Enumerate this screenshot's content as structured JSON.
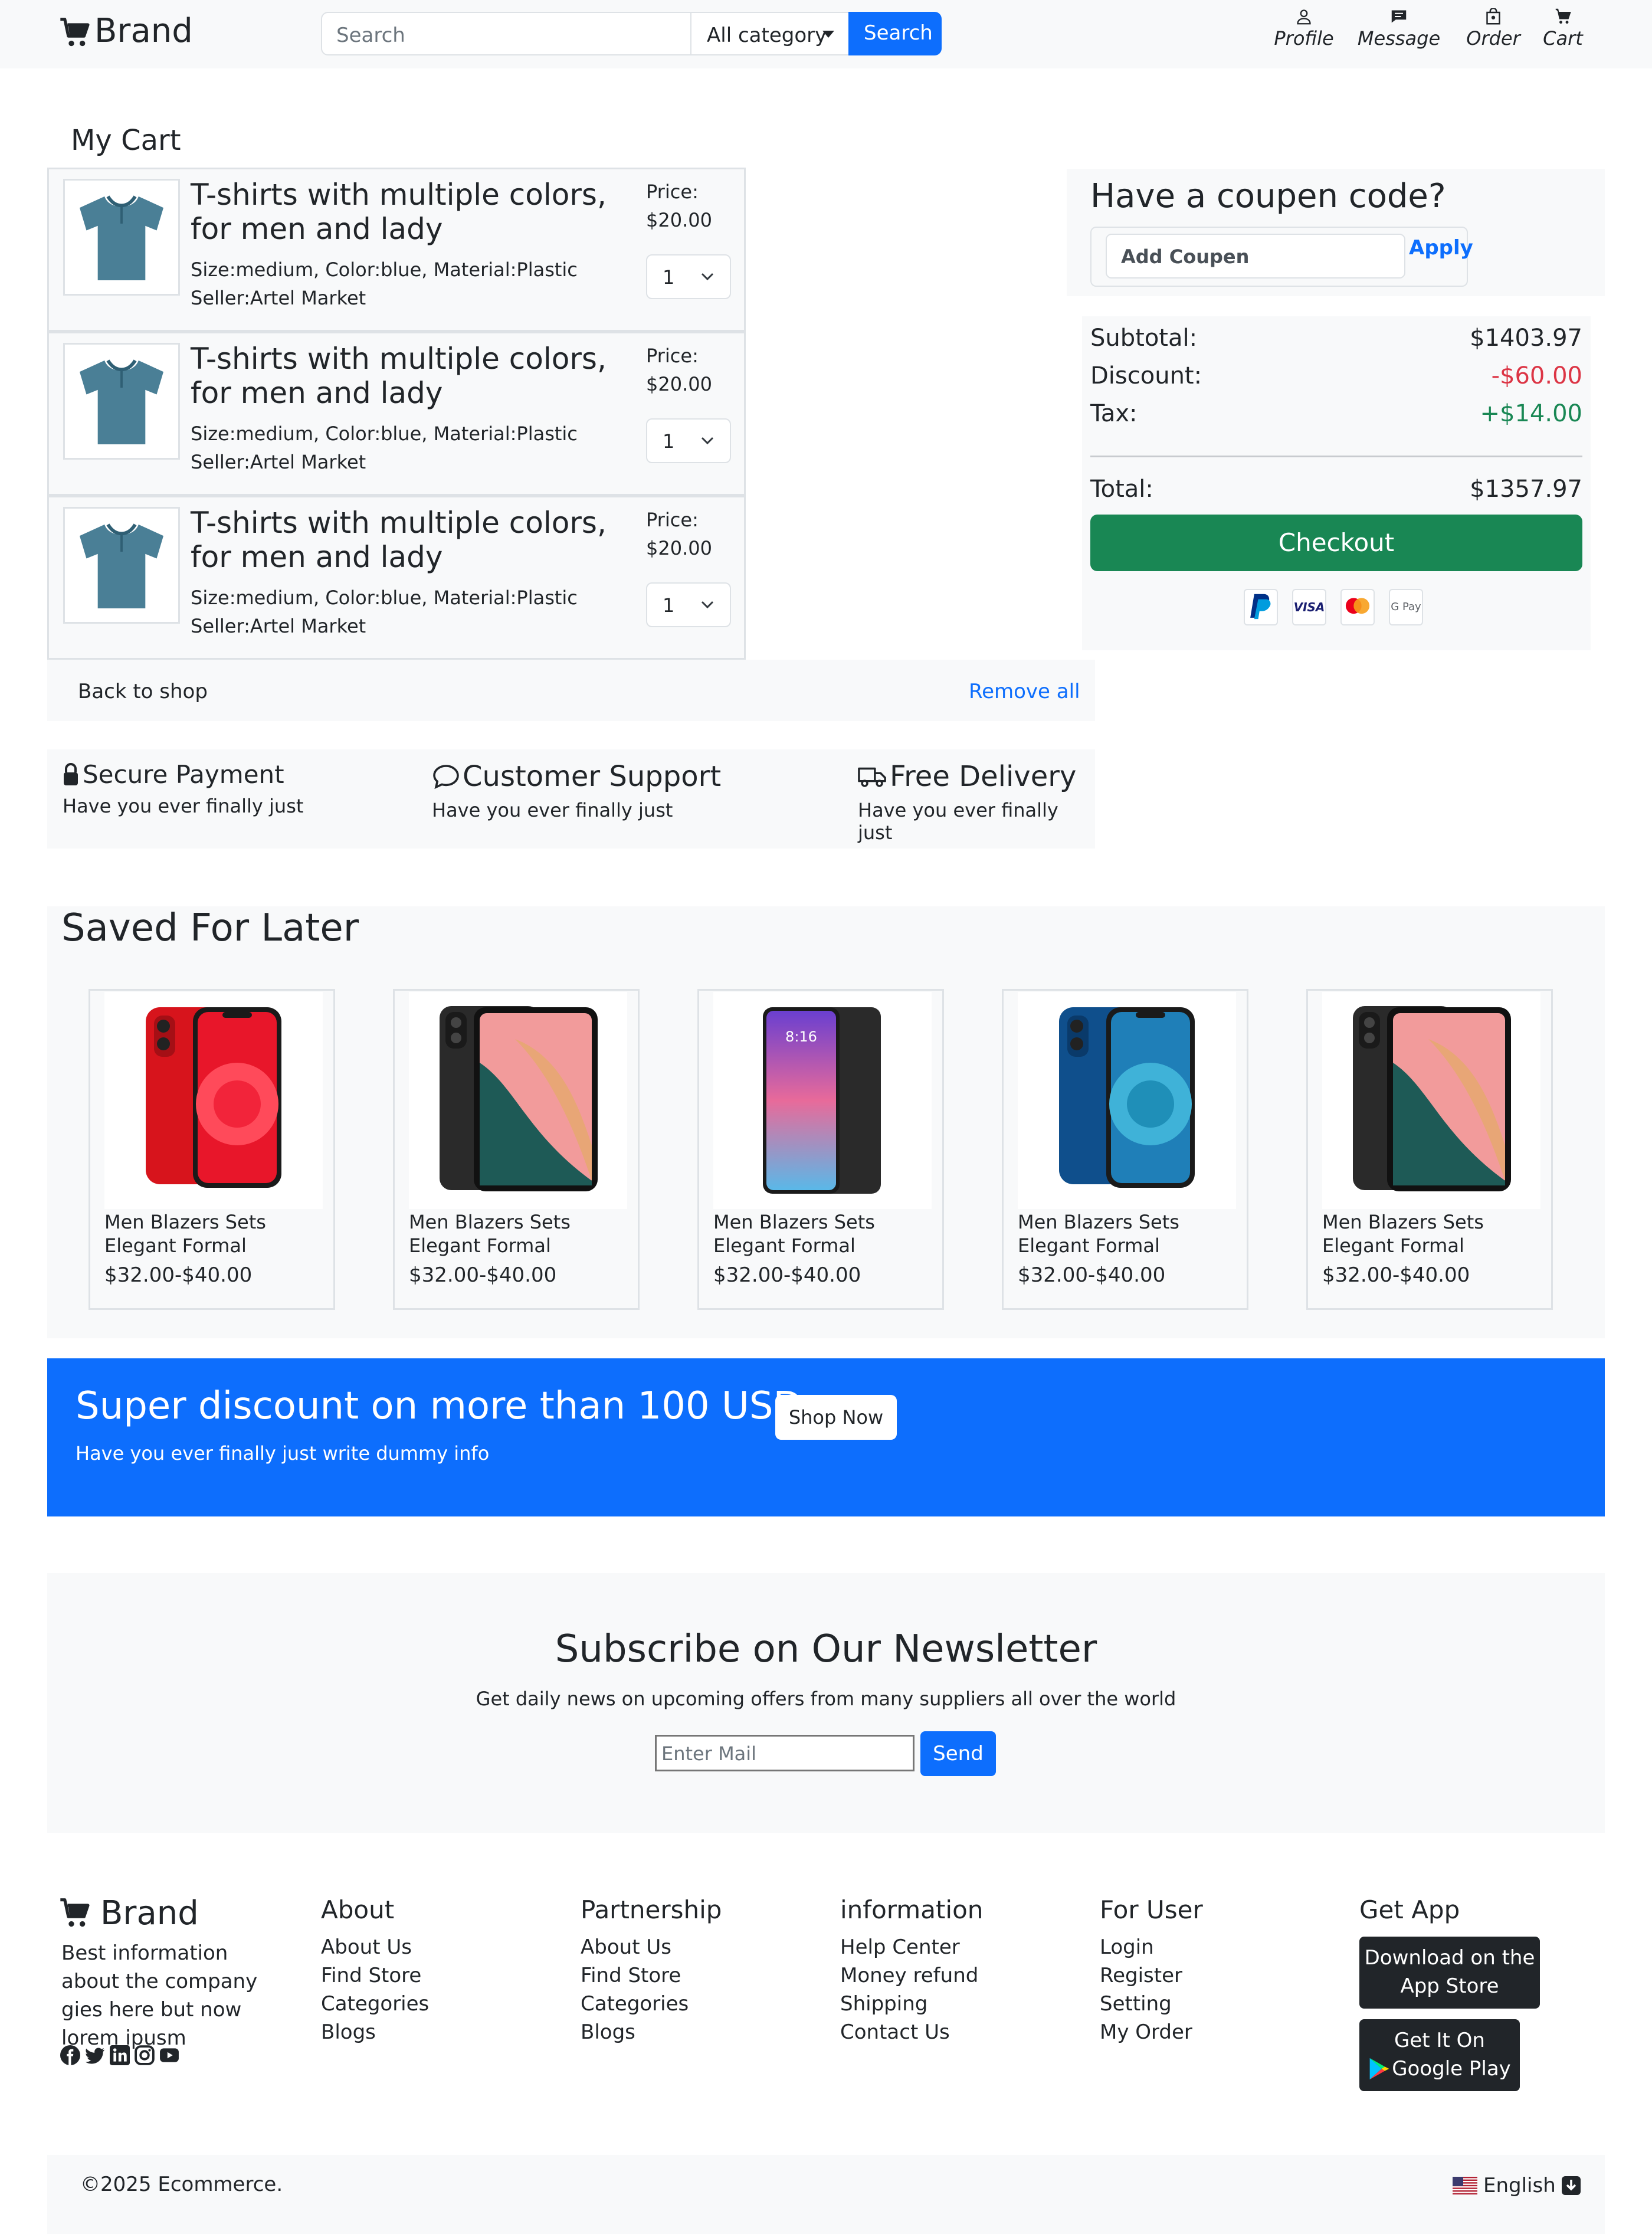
{
  "header": {
    "brand": "Brand",
    "search_placeholder": "Search",
    "category_selected": "All category",
    "search_button": "Search",
    "nav": [
      {
        "label": "Profile",
        "icon": "person-icon"
      },
      {
        "label": "Message",
        "icon": "message-icon"
      },
      {
        "label": "Order",
        "icon": "bag-icon"
      },
      {
        "label": "Cart",
        "icon": "cart-icon"
      }
    ]
  },
  "cart": {
    "heading": "My Cart",
    "items": [
      {
        "title": "T-shirts with multiple colors, for men and lady",
        "meta": "Size:medium, Color:blue, Material:Plastic",
        "seller": "Seller:Artel Market",
        "price_label": "Price:",
        "price": "$20.00",
        "qty": "1"
      },
      {
        "title": "T-shirts with multiple colors, for men and lady",
        "meta": "Size:medium, Color:blue, Material:Plastic",
        "seller": "Seller:Artel Market",
        "price_label": "Price:",
        "price": "$20.00",
        "qty": "1"
      },
      {
        "title": "T-shirts with multiple colors, for men and lady",
        "meta": "Size:medium, Color:blue, Material:Plastic",
        "seller": "Seller:Artel Market",
        "price_label": "Price:",
        "price": "$20.00",
        "qty": "1"
      }
    ],
    "back_to_shop": "Back to shop",
    "remove_all": "Remove all"
  },
  "features": [
    {
      "title": "Secure Payment",
      "subtitle": "Have you ever finally just",
      "icon": "lock-icon"
    },
    {
      "title": "Customer Support",
      "subtitle": "Have you ever finally just",
      "icon": "chat-icon"
    },
    {
      "title": "Free Delivery",
      "subtitle": "Have you ever finally just",
      "icon": "truck-icon"
    }
  ],
  "coupon": {
    "heading": "Have a coupen code?",
    "placeholder": "Add Coupen",
    "apply": "Apply"
  },
  "summary": {
    "subtotal_label": "Subtotal:",
    "subtotal": "$1403.97",
    "discount_label": "Discount:",
    "discount": "-$60.00",
    "tax_label": "Tax:",
    "tax": "+$14.00",
    "total_label": "Total:",
    "total": "$1357.97",
    "checkout": "Checkout",
    "payment_icons": [
      "paypal-icon",
      "visa-icon",
      "mastercard-icon",
      "gpay-icon"
    ],
    "visa_text": "VISA",
    "gpay_text": "G Pay"
  },
  "saved": {
    "heading": "Saved For Later",
    "products": [
      {
        "name": "Men Blazers Sets Elegant Formal",
        "price": "$32.00-$40.00",
        "image": "red-phone-image"
      },
      {
        "name": "Men Blazers Sets Elegant Formal",
        "price": "$32.00-$40.00",
        "image": "tablet-image"
      },
      {
        "name": "Men Blazers Sets Elegant Formal",
        "price": "$32.00-$40.00",
        "image": "android-phone-image",
        "screen_time": "8:16"
      },
      {
        "name": "Men Blazers Sets Elegant Formal",
        "price": "$32.00-$40.00",
        "image": "blue-phone-image"
      },
      {
        "name": "Men Blazers Sets Elegant Formal",
        "price": "$32.00-$40.00",
        "image": "tablet-image"
      }
    ]
  },
  "banner": {
    "title": "Super discount on more than 100 USD",
    "subtitle": "Have you ever finally just write dummy info",
    "button": "Shop Now"
  },
  "newsletter": {
    "title": "Subscribe on Our Newsletter",
    "subtitle": "Get daily news on upcoming offers from many suppliers all over the world",
    "placeholder": "Enter Mail",
    "button": "Send"
  },
  "footer": {
    "brand": "Brand",
    "description": "Best information about the company gies here but now lorem ipusm",
    "social_icons": [
      "facebook-icon",
      "twitter-icon",
      "linkedin-icon",
      "instagram-icon",
      "youtube-icon"
    ],
    "columns": [
      {
        "heading": "About",
        "links": [
          "About Us",
          "Find Store",
          "Categories",
          "Blogs"
        ]
      },
      {
        "heading": "Partnership",
        "links": [
          "About Us",
          "Find Store",
          "Categories",
          "Blogs"
        ]
      },
      {
        "heading": "information",
        "links": [
          "Help Center",
          "Money refund",
          "Shipping",
          "Contact Us"
        ]
      },
      {
        "heading": "For User",
        "links": [
          "Login",
          "Register",
          "Setting",
          "My Order"
        ]
      }
    ],
    "get_app": {
      "heading": "Get App",
      "app_store_line1": "Download on the",
      "app_store_line2": "App Store",
      "google_line1": "Get It On",
      "google_line2": "Google Play"
    },
    "copyright": "©2025 Ecommerce.",
    "language": "English"
  },
  "colors": {
    "primary": "#0d6efd",
    "success": "#198754",
    "danger": "#dc3545",
    "light_bg": "#f8f9fa",
    "border": "#dee2e6"
  }
}
